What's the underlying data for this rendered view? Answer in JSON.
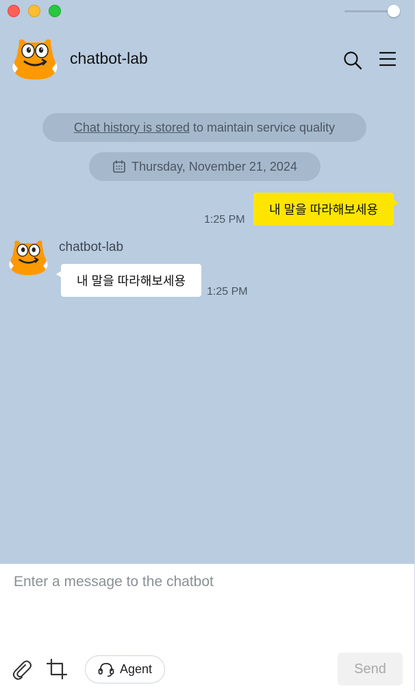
{
  "window": {
    "traffic_lights": [
      "close",
      "minimize",
      "maximize"
    ]
  },
  "header": {
    "title": "chatbot-lab",
    "avatar_icon": "smiling-orange-character-icon",
    "search_icon": "search-icon",
    "menu_icon": "hamburger-menu-icon"
  },
  "notice": {
    "link_text": "Chat history is stored",
    "rest_text": " to maintain service quality"
  },
  "date_divider": {
    "icon": "calendar-icon",
    "text": "Thursday, November 21, 2024"
  },
  "messages": [
    {
      "sender": "user",
      "text": "내 말을 따라해보세용",
      "time": "1:25 PM",
      "bubble_color": "#fee500"
    },
    {
      "sender": "bot",
      "name": "chatbot-lab",
      "text": "내 말을 따라해보세용",
      "time": "1:25 PM",
      "bubble_color": "#ffffff"
    }
  ],
  "composer": {
    "placeholder": "Enter a message to the chatbot",
    "value": "",
    "attach_icon": "paperclip-icon",
    "crop_icon": "crop-icon",
    "agent_label": "Agent",
    "agent_icon": "headset-icon",
    "send_label": "Send"
  },
  "colors": {
    "chat_background": "#b9cce0",
    "user_bubble": "#fee500",
    "bot_bubble": "#ffffff"
  }
}
